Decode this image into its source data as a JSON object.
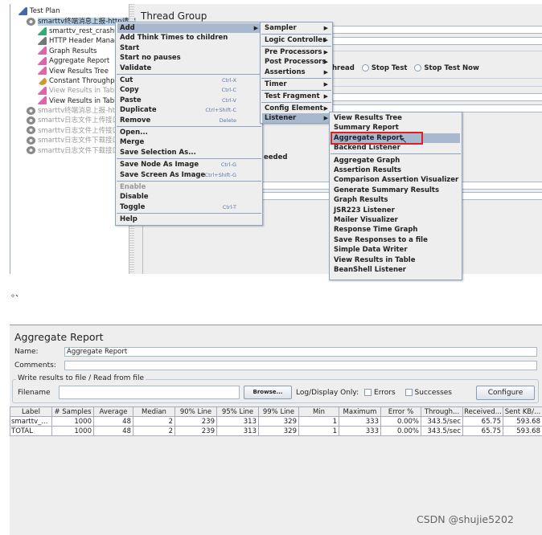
{
  "tree": {
    "root": "Test Plan",
    "selected": "smarttv终端消息上报-http请求",
    "children": [
      {
        "label": "smarttv_rest_crashu",
        "icon": "sampler-icon",
        "disabled": false
      },
      {
        "label": "HTTP Header Manag",
        "icon": "config-icon",
        "disabled": false
      },
      {
        "label": "Graph Results",
        "icon": "listener-icon",
        "disabled": false
      },
      {
        "label": "Aggregate Report",
        "icon": "listener-icon",
        "disabled": false
      },
      {
        "label": "View Results Tree",
        "icon": "listener-icon",
        "disabled": false
      },
      {
        "label": "Constant Throughpu",
        "icon": "timer-icon",
        "disabled": false
      },
      {
        "label": "View Results in Table",
        "icon": "listener-icon",
        "disabled": true
      },
      {
        "label": "View Results in Table",
        "icon": "listener-icon",
        "disabled": false
      }
    ],
    "thread_groups": [
      "smarttv终端消息上报-http",
      "smarttv日志文件上传接口_",
      "smarttv日志文件上传接口_",
      "smarttv日志文件下载接口_",
      "smarttv日志文件下载接口_"
    ]
  },
  "thread_group": {
    "title": "Thread Group",
    "partial_radio_label": "hread",
    "stop_test": "Stop Test",
    "stop_test_now": "Stop Test Now",
    "partial_text": "eeded"
  },
  "context_menu": [
    {
      "label": "Add",
      "submenu": true,
      "highlighted": true
    },
    {
      "label": "Add Think Times to children"
    },
    {
      "label": "Start"
    },
    {
      "label": "Start no pauses"
    },
    {
      "label": "Validate"
    },
    {
      "sep": true
    },
    {
      "label": "Cut",
      "shortcut": "Ctrl-X"
    },
    {
      "label": "Copy",
      "shortcut": "Ctrl-C"
    },
    {
      "label": "Paste",
      "shortcut": "Ctrl-V"
    },
    {
      "label": "Duplicate",
      "shortcut": "Ctrl+Shift-C"
    },
    {
      "label": "Remove",
      "shortcut": "Delete"
    },
    {
      "sep": true
    },
    {
      "label": "Open..."
    },
    {
      "label": "Merge"
    },
    {
      "label": "Save Selection As..."
    },
    {
      "sep": true
    },
    {
      "label": "Save Node As Image",
      "shortcut": "Ctrl-G"
    },
    {
      "label": "Save Screen As Image",
      "shortcut": "Ctrl+Shift-G"
    },
    {
      "sep": true
    },
    {
      "label": "Enable",
      "disabled": true
    },
    {
      "label": "Disable"
    },
    {
      "label": "Toggle",
      "shortcut": "Ctrl-T"
    },
    {
      "sep": true
    },
    {
      "label": "Help"
    }
  ],
  "add_submenu": [
    {
      "label": "Sampler",
      "submenu": true
    },
    {
      "sep": true
    },
    {
      "label": "Logic Controller",
      "submenu": true
    },
    {
      "sep": true
    },
    {
      "label": "Pre Processors",
      "submenu": true
    },
    {
      "label": "Post Processors",
      "submenu": true
    },
    {
      "label": "Assertions",
      "submenu": true
    },
    {
      "sep": true
    },
    {
      "label": "Timer",
      "submenu": true
    },
    {
      "sep": true
    },
    {
      "label": "Test Fragment",
      "submenu": true
    },
    {
      "sep": true
    },
    {
      "label": "Config Element",
      "submenu": true
    },
    {
      "label": "Listener",
      "submenu": true,
      "highlighted": true
    }
  ],
  "listener_submenu": [
    {
      "label": "View Results Tree"
    },
    {
      "label": "Summary Report"
    },
    {
      "label": "Aggregate Report",
      "highlighted": true,
      "annotated": true
    },
    {
      "label": "Backend Listener"
    },
    {
      "sep": true
    },
    {
      "label": "Aggregate Graph"
    },
    {
      "label": "Assertion Results"
    },
    {
      "label": "Comparison Assertion Visualizer"
    },
    {
      "label": "Generate Summary Results"
    },
    {
      "label": "Graph Results"
    },
    {
      "label": "JSR223 Listener"
    },
    {
      "label": "Mailer Visualizer"
    },
    {
      "label": "Response Time Graph"
    },
    {
      "label": "Save Responses to a file"
    },
    {
      "label": "Simple Data Writer"
    },
    {
      "label": "View Results in Table"
    },
    {
      "label": "BeanShell Listener"
    }
  ],
  "between_text": "。、",
  "report": {
    "title": "Aggregate Report",
    "name_label": "Name:",
    "name_value": "Aggregate Report",
    "comments_label": "Comments:",
    "comments_value": "",
    "file_group": "Write results to file / Read from file",
    "filename_label": "Filename",
    "filename_value": "",
    "browse": "Browse...",
    "log_display": "Log/Display Only:",
    "errors": "Errors",
    "successes": "Successes",
    "configure": "Configure",
    "columns": [
      "Label",
      "# Samples",
      "Average",
      "Median",
      "90% Line",
      "95% Line",
      "99% Line",
      "Min",
      "Maximum",
      "Error %",
      "Through...",
      "Received...",
      "Sent KB/..."
    ],
    "rows": [
      [
        "smarttv_...",
        "1000",
        "48",
        "2",
        "239",
        "313",
        "329",
        "1",
        "333",
        "0.00%",
        "343.5/sec",
        "65.75",
        "593.68"
      ],
      [
        "TOTAL",
        "1000",
        "48",
        "2",
        "239",
        "313",
        "329",
        "1",
        "333",
        "0.00%",
        "343.5/sec",
        "65.75",
        "593.68"
      ]
    ]
  },
  "watermark": "CSDN @shujie5202",
  "colors": {
    "menu_highlight": "#a7b8cf",
    "annotation": "#e02020",
    "menu_border": "#8da3c4"
  }
}
